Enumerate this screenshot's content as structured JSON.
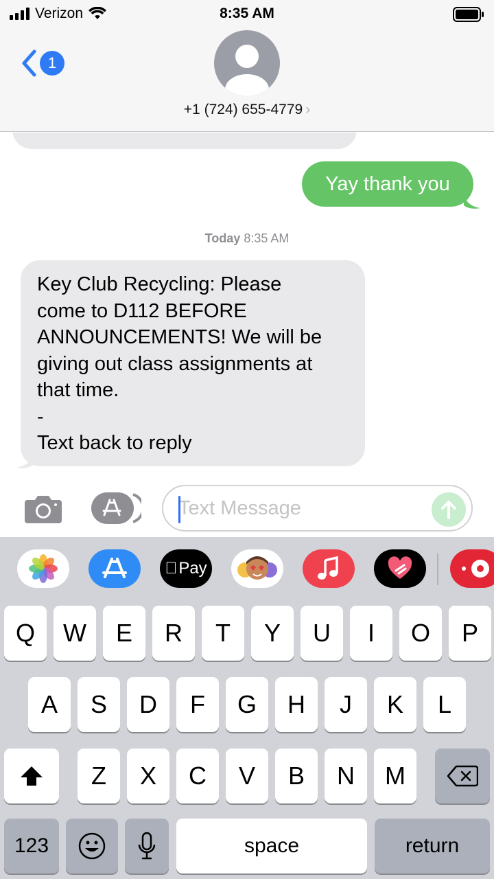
{
  "status_bar": {
    "carrier": "Verizon",
    "time": "8:35 AM"
  },
  "header": {
    "back_badge": "1",
    "contact": "+1 (724) 655-4779",
    "chevron": "›"
  },
  "messages": {
    "outgoing_1": "Yay thank you",
    "timestamp_day": "Today",
    "timestamp_time": "8:35 AM",
    "incoming_lines": [
      "Key Club Recycling: Please",
      "come to D112 BEFORE",
      "ANNOUNCEMENTS! We will be",
      "giving out class assignments at",
      "that time.",
      "-",
      "Text back to reply"
    ]
  },
  "input": {
    "placeholder": "Text Message",
    "value": ""
  },
  "app_strip": {
    "apps": [
      "photos-icon",
      "app-store-icon",
      "apple-pay",
      "memoji-stickers-icon",
      "music-icon",
      "digital-touch-icon",
      "more-app-icon"
    ],
    "apple_pay_label": "Pay"
  },
  "keyboard": {
    "row1": [
      "Q",
      "W",
      "E",
      "R",
      "T",
      "Y",
      "U",
      "I",
      "O",
      "P"
    ],
    "row2": [
      "A",
      "S",
      "D",
      "F",
      "G",
      "H",
      "J",
      "K",
      "L"
    ],
    "row3": [
      "Z",
      "X",
      "C",
      "V",
      "B",
      "N",
      "M"
    ],
    "numbers_label": "123",
    "space_label": "space",
    "return_label": "return"
  }
}
